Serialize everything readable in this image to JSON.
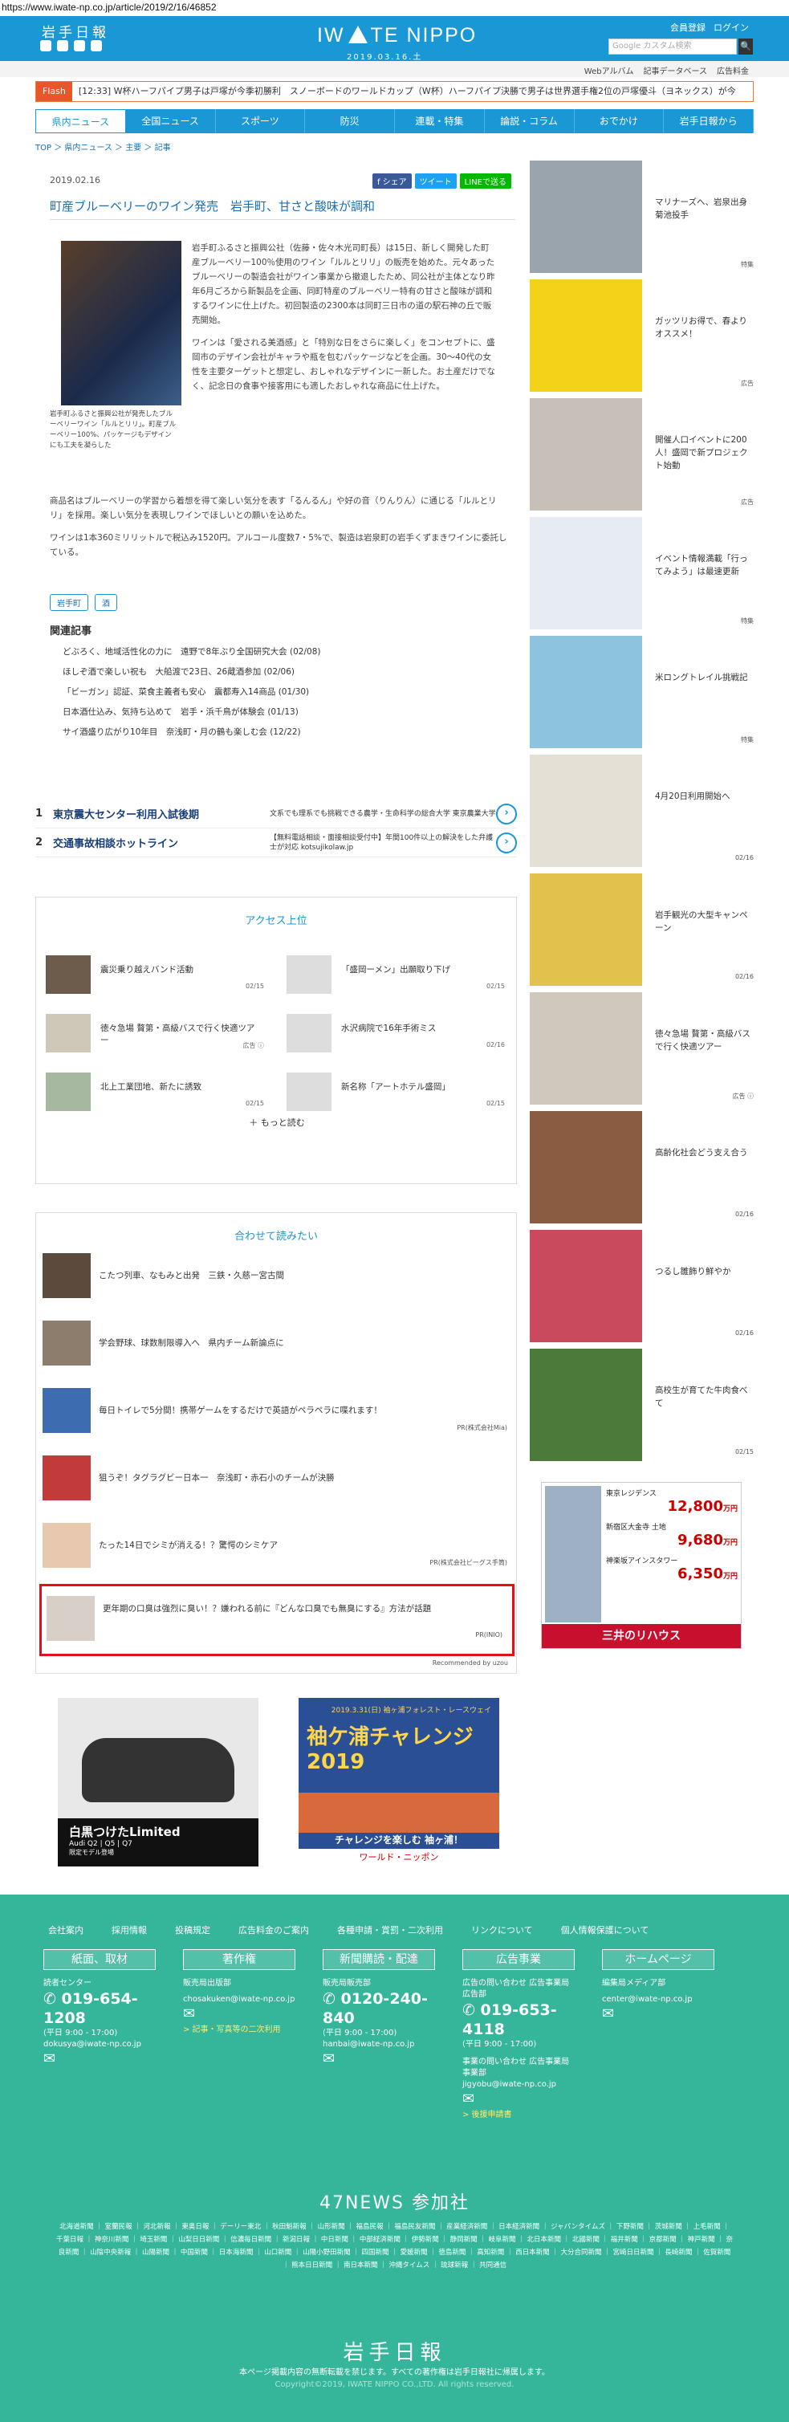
{
  "url": "https://www.iwate-np.co.jp/article/2019/2/16/46852",
  "header": {
    "logo_text": "岩手日報",
    "brand_a": "IW",
    "brand_b": "TE NIPPO",
    "date": "2019.03.16.土",
    "member_register": "会員登録",
    "login": "ログイン",
    "search_placeholder": "Google カスタム検索",
    "search_button": "🔍"
  },
  "subbar": {
    "links": [
      "Webアルバム",
      "記事データベース",
      "広告料金"
    ]
  },
  "flash": {
    "tag": "Flash",
    "text": "[12:33] W杯ハーフパイプ男子は戸塚が今季初勝利　スノーボードのワールドカップ（W杯）ハーフパイプ決勝で男子は世界選手権2位の戸塚優斗（ヨネックス）が今"
  },
  "nav": [
    "県内ニュース",
    "全国ニュース",
    "スポーツ",
    "防災",
    "連載・特集",
    "論説・コラム",
    "おでかけ",
    "岩手日報から"
  ],
  "breadcrumb": "TOP ＞ 県内ニュース ＞ 主要 ＞ 記事",
  "article": {
    "date": "2019.02.16",
    "share_fb": "f シェア",
    "share_tw": "ツイート",
    "share_line": "LINEで送る",
    "title": "町産ブルーベリーのワイン発売　岩手町、甘さと酸味が調和",
    "caption": "岩手町ふるさと振興公社が発売したブルーベリーワイン「ルルとリリ」。町産ブルーベリー100%、パッケージもデザインにも工夫を凝らした",
    "p1": "岩手町ふるさと振興公社（佐藤・佐々木光司町長）は15日、新しく開発した町産ブルーベリー100％使用のワイン「ルルとリリ」の販売を始めた。元々あったブルーベリーの製造会社がワイン事業から撤退したため、同公社が主体となり昨年6月ごろから新製品を企画、同町特産のブルーベリー特有の甘さと酸味が調和するワインに仕上げた。初回製造の2300本は同町三日市の道の駅石神の丘で販売開始。",
    "p2": "ワインは「愛される美酒感」と「特別な日をさらに楽しく」をコンセプトに、盛岡市のデザイン会社がキャラや瓶を包むパッケージなどを企画。30～40代の女性を主要ターゲットと想定し、おしゃれなデザインに一新した。お土産だけでなく、記念日の食事や接客用にも適したおしゃれな商品に仕上げた。",
    "p3": "商品名はブルーベリーの学習から着想を得て楽しい気分を表す「るんるん」や好の音（りんりん）に通じる「ルルとリリ」を採用。楽しい気分を表現しワインでほしいとの願いを込めた。",
    "p4": "ワインは1本360ミリリットルで税込み1520円。アルコール度数7・5%で、製造は岩泉町の岩手くずまきワインに委託している。",
    "tags": [
      "岩手町",
      "酒"
    ],
    "related_title": "関連記事",
    "related": [
      "どぶろく、地域活性化の力に　遠野で8年ぶり全国研究大会 (02/08)",
      "ほしぞ酒で楽しい祝も　大船渡で23日、26蔵酒参加 (02/06)",
      "「ビーガン」認証、菜食主義者も安心　震都寿入14商品 (01/30)",
      "日本酒仕込み、気持ち込めて　岩手・浜千鳥が体験会 (01/13)",
      "サイ酒盛り広がり10年目　奈浅町・月の鶴も楽しむ会 (12/22)"
    ]
  },
  "text_ads": [
    {
      "num": "1",
      "title": "東京震大センター利用入試後期",
      "desc": "文系でも理系でも挑戦できる農学・生命科学の総合大学 東京農業大学"
    },
    {
      "num": "2",
      "title": "交通事故相談ホットライン",
      "desc": "【無料電話相談・面接相談受付中】年間100件以上の解決をした弁護士が対応 kotsujikolaw.jp"
    }
  ],
  "access": {
    "title": "アクセス上位",
    "items": [
      {
        "text": "震災乗り越えバンド活動",
        "date": "02/15"
      },
      {
        "text": "「盛岡ーメン」出願取り下げ",
        "date": "02/15"
      },
      {
        "text": "徳々急場 贅第・高級バスで行く快適ツアー",
        "date": "広告 ⓘ"
      },
      {
        "text": "水沢病院で16年手術ミス",
        "date": "02/16"
      },
      {
        "text": "北上工業団地、新たに誘致",
        "date": "02/15"
      },
      {
        "text": "新名称「アートホテル盛岡」",
        "date": "02/15"
      }
    ],
    "more": "もっと読む"
  },
  "recommend": {
    "title": "合わせて読みたい",
    "items": [
      {
        "text": "こたつ列車、なもみと出発　三鉄・久慈ー宮古間",
        "pr": ""
      },
      {
        "text": "学会野球、球数制限導入へ　県内チーム新論点に",
        "pr": ""
      },
      {
        "text": "毎日トイレで5分間！携帯ゲームをするだけで英語がペラペラに喋れます！",
        "pr": "PR(株式会社Mia)"
      },
      {
        "text": "狙うぞ！タグラグビー日本一　奈浅町・赤石小のチームが決勝",
        "pr": ""
      },
      {
        "text": "たった14日でシミが消える！？驚愕のシミケア",
        "pr": "PR(株式会社ビーグス手筒)"
      },
      {
        "text": "更年期の口臭は強烈に臭い！？嫌われる前に『どんな口臭でも無臭にする』方法が話題",
        "pr": "PR(INIO)"
      }
    ],
    "powered": "Recommended by uzou"
  },
  "side": [
    {
      "text": "マリナーズへ、岩泉出身菊池投手",
      "tag": "特集"
    },
    {
      "text": "ガッツリお得で、春よりオススメ！",
      "tag": "広告"
    },
    {
      "text": "開催人口イベントに200人！盛岡で新プロジェクト始動",
      "tag": "広告"
    },
    {
      "text": "イベント情報満載「行ってみよう」は最速更新",
      "tag": "特集"
    },
    {
      "text": "米ロングトレイル挑戦記",
      "tag": "特集"
    },
    {
      "text": "4月20日利用開始へ",
      "tag": "02/16"
    },
    {
      "text": "岩手観光の大型キャンペーン",
      "tag": "02/16"
    },
    {
      "text": "徳々急場 贅第・高級バスで行く快適ツアー",
      "tag": "広告 ⓘ"
    },
    {
      "text": "高齢化社会どう支え合う",
      "tag": "02/16"
    },
    {
      "text": "つるし雛飾り鮮やか",
      "tag": "02/16"
    },
    {
      "text": "高校生が育てた牛肉食べて",
      "tag": "02/15"
    }
  ],
  "side_ad": {
    "rows": [
      {
        "name": "東京レジデンス",
        "price": "12,800"
      },
      {
        "name": "新宿区大金寺 土地",
        "price": "9,680"
      },
      {
        "name": "神楽坂アインスタワー",
        "price": "6,350"
      }
    ],
    "unit": "万円",
    "brand": "三井のリハウス"
  },
  "banners": {
    "audi_title": "白黒つけたLimited",
    "audi_sub": "Audi Q2 | Q5 | Q7",
    "audi_note": "限定モデル登場",
    "sode_date": "2019.3.31(日) 袖ヶ浦フォレスト・レースウェイ",
    "sode_title": "袖ケ浦チャレンジ2019",
    "sode_tag": "チャレンジを楽しむ 袖ヶ浦！",
    "sode_sponsor": "ワールド・ニッポン"
  },
  "footer": {
    "links": [
      "会社案内",
      "採用情報",
      "投稿規定",
      "広告料金のご案内",
      "各種申請・賞罰・二次利用",
      "リンクについて",
      "個人情報保護について"
    ],
    "cols": [
      {
        "head": "紙面、取材",
        "label": "読者センター",
        "phone": "019-654-1208",
        "hours": "(平日 9:00 - 17:00)",
        "email": "dokusya@iwate-np.co.jp",
        "extra": ""
      },
      {
        "head": "著作権",
        "label": "販売局出版部",
        "phone": "",
        "hours": "",
        "email": "chosakuken@iwate-np.co.jp",
        "extra": "> 記事・写真等の二次利用"
      },
      {
        "head": "新聞購読・配達",
        "label": "販売局販売部",
        "phone": "0120-240-840",
        "hours": "(平日 9:00 - 17:00)",
        "email": "hanbai@iwate-np.co.jp",
        "extra": ""
      },
      {
        "head": "広告事業",
        "label": "広告の問い合わせ 広告事業局広告部",
        "phone": "019-653-4118",
        "hours": "(平日 9:00 - 17:00)",
        "email": "jigyobu@iwate-np.co.jp",
        "extra": "> 後援申請書"
      },
      {
        "head": "ホームページ",
        "label": "編集局メディア部",
        "phone": "",
        "hours": "",
        "email": "center@iwate-np.co.jp",
        "extra": ""
      }
    ],
    "jigyo_label": "事業の問い合わせ 広告事業局事業部",
    "n47": "47NEWS 参加社",
    "papers": "北海道新聞 ｜ 室蘭民報 ｜ 河北新報 ｜ 東奥日報 ｜ デーリー東北 ｜ 秋田魁新報 ｜ 山形新聞 ｜ 福島民報 ｜ 福島民友新聞 ｜ 産業経済新聞 ｜ 日本経済新聞 ｜ ジャパンタイムズ ｜ 下野新聞 ｜ 茨城新聞 ｜ 上毛新聞 ｜ 千葉日報 ｜ 神奈川新聞 ｜ 埼玉新聞 ｜ 山梨日日新聞 ｜ 信濃毎日新聞 ｜ 新潟日報 ｜ 中日新聞 ｜ 中部経済新聞 ｜ 伊勢新聞 ｜ 静岡新聞 ｜ 岐阜新聞 ｜ 北日本新聞 ｜ 北國新聞 ｜ 福井新聞 ｜ 京都新聞 ｜ 神戸新聞 ｜ 奈良新聞 ｜ 山陰中央新報 ｜ 山陽新聞 ｜ 中国新聞 ｜ 日本海新聞 ｜ 山口新聞 ｜ 山陽小野田新聞 ｜ 四国新聞 ｜ 愛媛新聞 ｜ 徳島新聞 ｜ 高知新聞 ｜ 西日本新聞 ｜ 大分合同新聞 ｜ 宮崎日日新聞 ｜ 長崎新聞 ｜ 佐賀新聞 ｜ 熊本日日新聞 ｜ 南日本新聞 ｜ 沖縄タイムス ｜ 琉球新報 ｜ 共同通信",
    "logo": "岩手日報",
    "note": "本ページ掲載内容の無断転載を禁じます。すべての著作権は岩手日報社に帰属します。",
    "copyright": "Copyright©2019, IWATE NIPPO CO.,LTD. All rights reserved."
  }
}
